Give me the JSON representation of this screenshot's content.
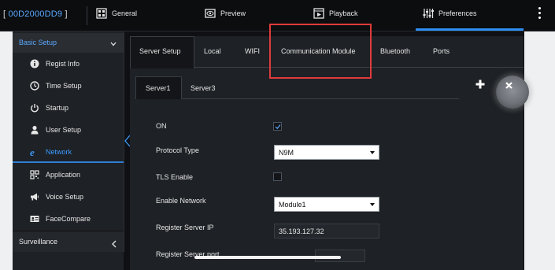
{
  "device": {
    "open": "[",
    "id": "00D2000DD9",
    "close": "]"
  },
  "topnav": [
    {
      "label": "General",
      "icon": "general-icon"
    },
    {
      "label": "Preview",
      "icon": "preview-icon"
    },
    {
      "label": "Playback",
      "icon": "playback-icon"
    },
    {
      "label": "Preferences",
      "icon": "preferences-icon"
    }
  ],
  "colors": {
    "accent": "#2d8df0",
    "highlight": "#e03b3b",
    "panel": "#1e2125"
  },
  "sidebar": {
    "section": "Basic Setup",
    "items": [
      {
        "label": "Regist Info",
        "icon": "info-icon"
      },
      {
        "label": "Time Setup",
        "icon": "clock-icon"
      },
      {
        "label": "Startup",
        "icon": "power-icon"
      },
      {
        "label": "User Setup",
        "icon": "user-icon"
      },
      {
        "label": "Network",
        "icon": "network-icon",
        "active": true
      },
      {
        "label": "Application",
        "icon": "qr-icon"
      },
      {
        "label": "Voice Setup",
        "icon": "megaphone-icon"
      },
      {
        "label": "FaceCompare",
        "icon": "id-card-icon"
      }
    ],
    "footer": "Surveillance"
  },
  "tabs": [
    "Server Setup",
    "Local",
    "WIFI",
    "Communication Module",
    "Bluetooth",
    "Ports"
  ],
  "subtabs": [
    "Server1",
    "Server3"
  ],
  "form": {
    "on_label": "ON",
    "on_checked": true,
    "protocol_label": "Protocol Type",
    "protocol_value": "N9M",
    "tls_label": "TLS Enable",
    "tls_checked": false,
    "enable_network_label": "Enable Network",
    "enable_network_value": "Module1",
    "register_ip_label": "Register Server IP",
    "register_ip_value": "35.193.127.32",
    "partial_label": "Register Server port"
  }
}
